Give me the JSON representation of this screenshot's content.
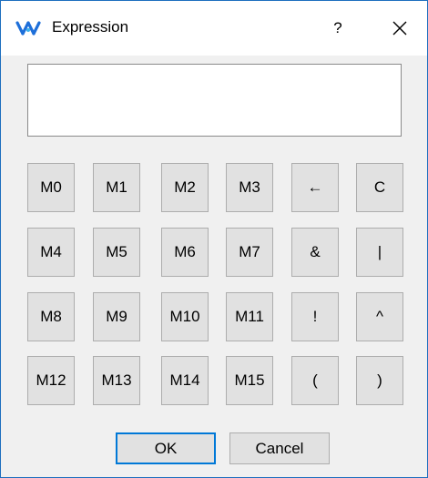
{
  "window": {
    "title": "Expression",
    "help_label": "?"
  },
  "expression": {
    "value": ""
  },
  "keys": [
    "M0",
    "M1",
    "M2",
    "M3",
    "←",
    "C",
    "M4",
    "M5",
    "M6",
    "M7",
    "&",
    "|",
    "M8",
    "M9",
    "M10",
    "M11",
    "!",
    "^",
    "M12",
    "M13",
    "M14",
    "M15",
    "(",
    ")"
  ],
  "buttons": {
    "ok_label": "OK",
    "cancel_label": "Cancel"
  },
  "colors": {
    "accent": "#0078d7",
    "logo": "#1e6fd9",
    "key_face": "#e1e1e1"
  }
}
